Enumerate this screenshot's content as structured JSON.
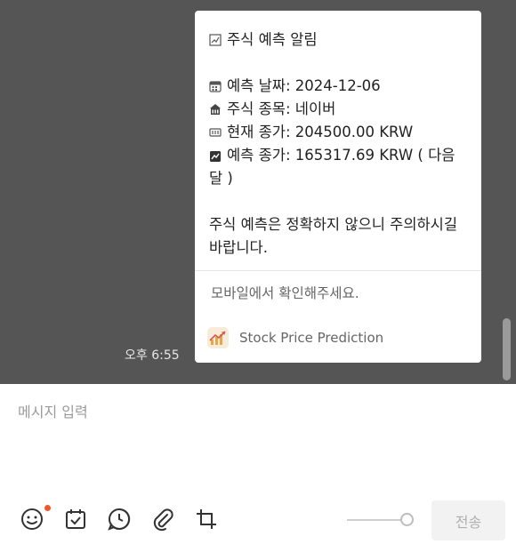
{
  "message": {
    "title": "주식 예측 알림",
    "date_line": "예측 날짜: 2024-12-06",
    "stock_line": "주식 종목: 네이버",
    "current_price_line": "현재 종가: 204500.00 KRW",
    "predicted_price_line": "예측 종가: 165317.69 KRW ( 다음 달 )",
    "warning": "주식 예측은 정확하지 않으니 주의하시길 바랍니다.",
    "mobile_note": "모바일에서 확인해주세요.",
    "app_name": "Stock Price Prediction",
    "timestamp": "오후 6:55"
  },
  "composer": {
    "placeholder": "메시지 입력",
    "send_label": "전송"
  },
  "icons": {
    "title": "chart-icon",
    "date": "calendar-icon",
    "stock": "building-icon",
    "current": "price-tag-icon",
    "predicted": "trend-chart-icon",
    "toolbar": [
      "emoji-icon",
      "calendar-check-icon",
      "clock-icon",
      "paperclip-icon",
      "crop-icon"
    ]
  },
  "colors": {
    "chat_background": "#555555",
    "notification_dot": "#f0582b",
    "send_disabled_bg": "#f2f2f2",
    "send_disabled_text": "#b0b0b0"
  }
}
